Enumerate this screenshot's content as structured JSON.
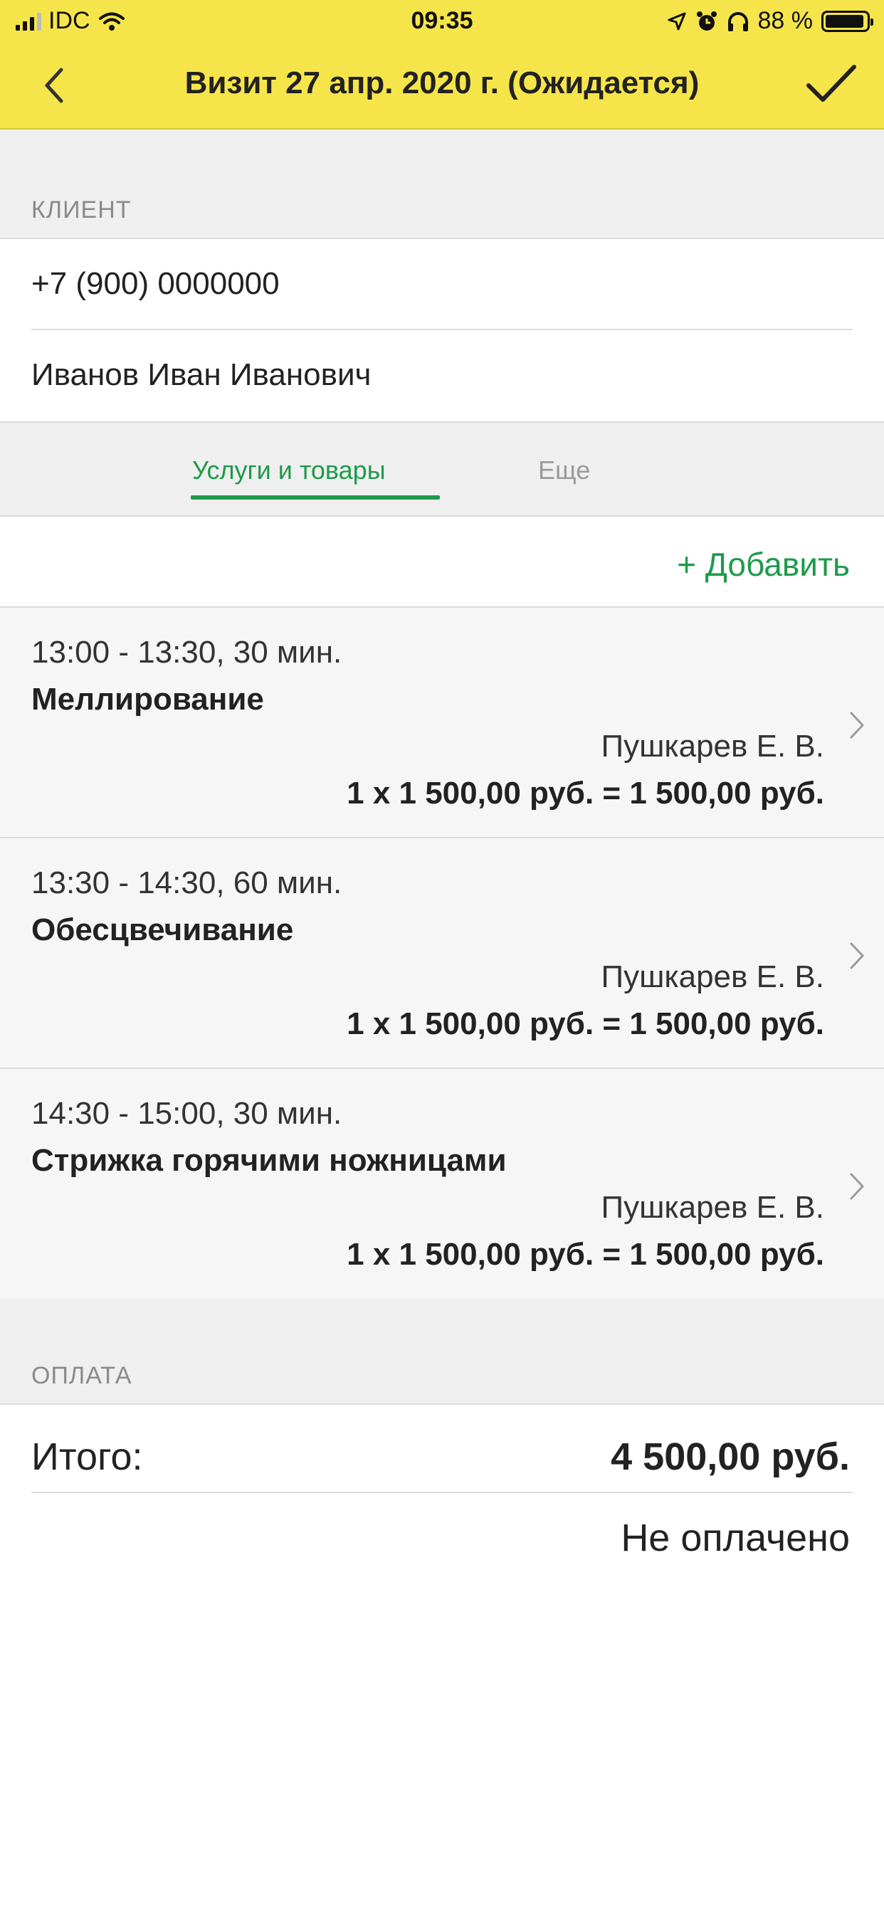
{
  "status_bar": {
    "carrier": "IDC",
    "time": "09:35",
    "battery_percent": "88 %",
    "battery_level": 0.88
  },
  "nav": {
    "title": "Визит 27 апр. 2020 г. (Ожидается)",
    "back_icon": "chevron-left-icon",
    "done_icon": "checkmark-icon"
  },
  "client": {
    "section_label": "КЛИЕНТ",
    "phone": "+7 (900) 0000000",
    "name": "Иванов Иван Иванович"
  },
  "tabs": [
    {
      "label": "Услуги и товары",
      "active": true
    },
    {
      "label": "Еще",
      "active": false
    }
  ],
  "add_label": "+ Добавить",
  "services": [
    {
      "time": "13:00 - 13:30, 30 мин.",
      "name": "Меллирование",
      "master": "Пушкарев Е. В.",
      "price": "1 x 1 500,00 руб. = 1 500,00 руб."
    },
    {
      "time": "13:30 - 14:30, 60 мин.",
      "name": "Обесцвечивание",
      "master": "Пушкарев Е. В.",
      "price": "1 x 1 500,00 руб. = 1 500,00 руб."
    },
    {
      "time": "14:30 - 15:00, 30 мин.",
      "name": "Стрижка горячими ножницами",
      "master": "Пушкарев Е. В.",
      "price": "1 x 1 500,00 руб. = 1 500,00 руб."
    }
  ],
  "payment": {
    "section_label": "ОПЛАТА",
    "total_label": "Итого:",
    "total_value": "4 500,00 руб.",
    "status": "Не оплачено"
  },
  "colors": {
    "header": "#f6e54a",
    "accent": "#1e9a4a",
    "section_bg": "#efefef"
  }
}
